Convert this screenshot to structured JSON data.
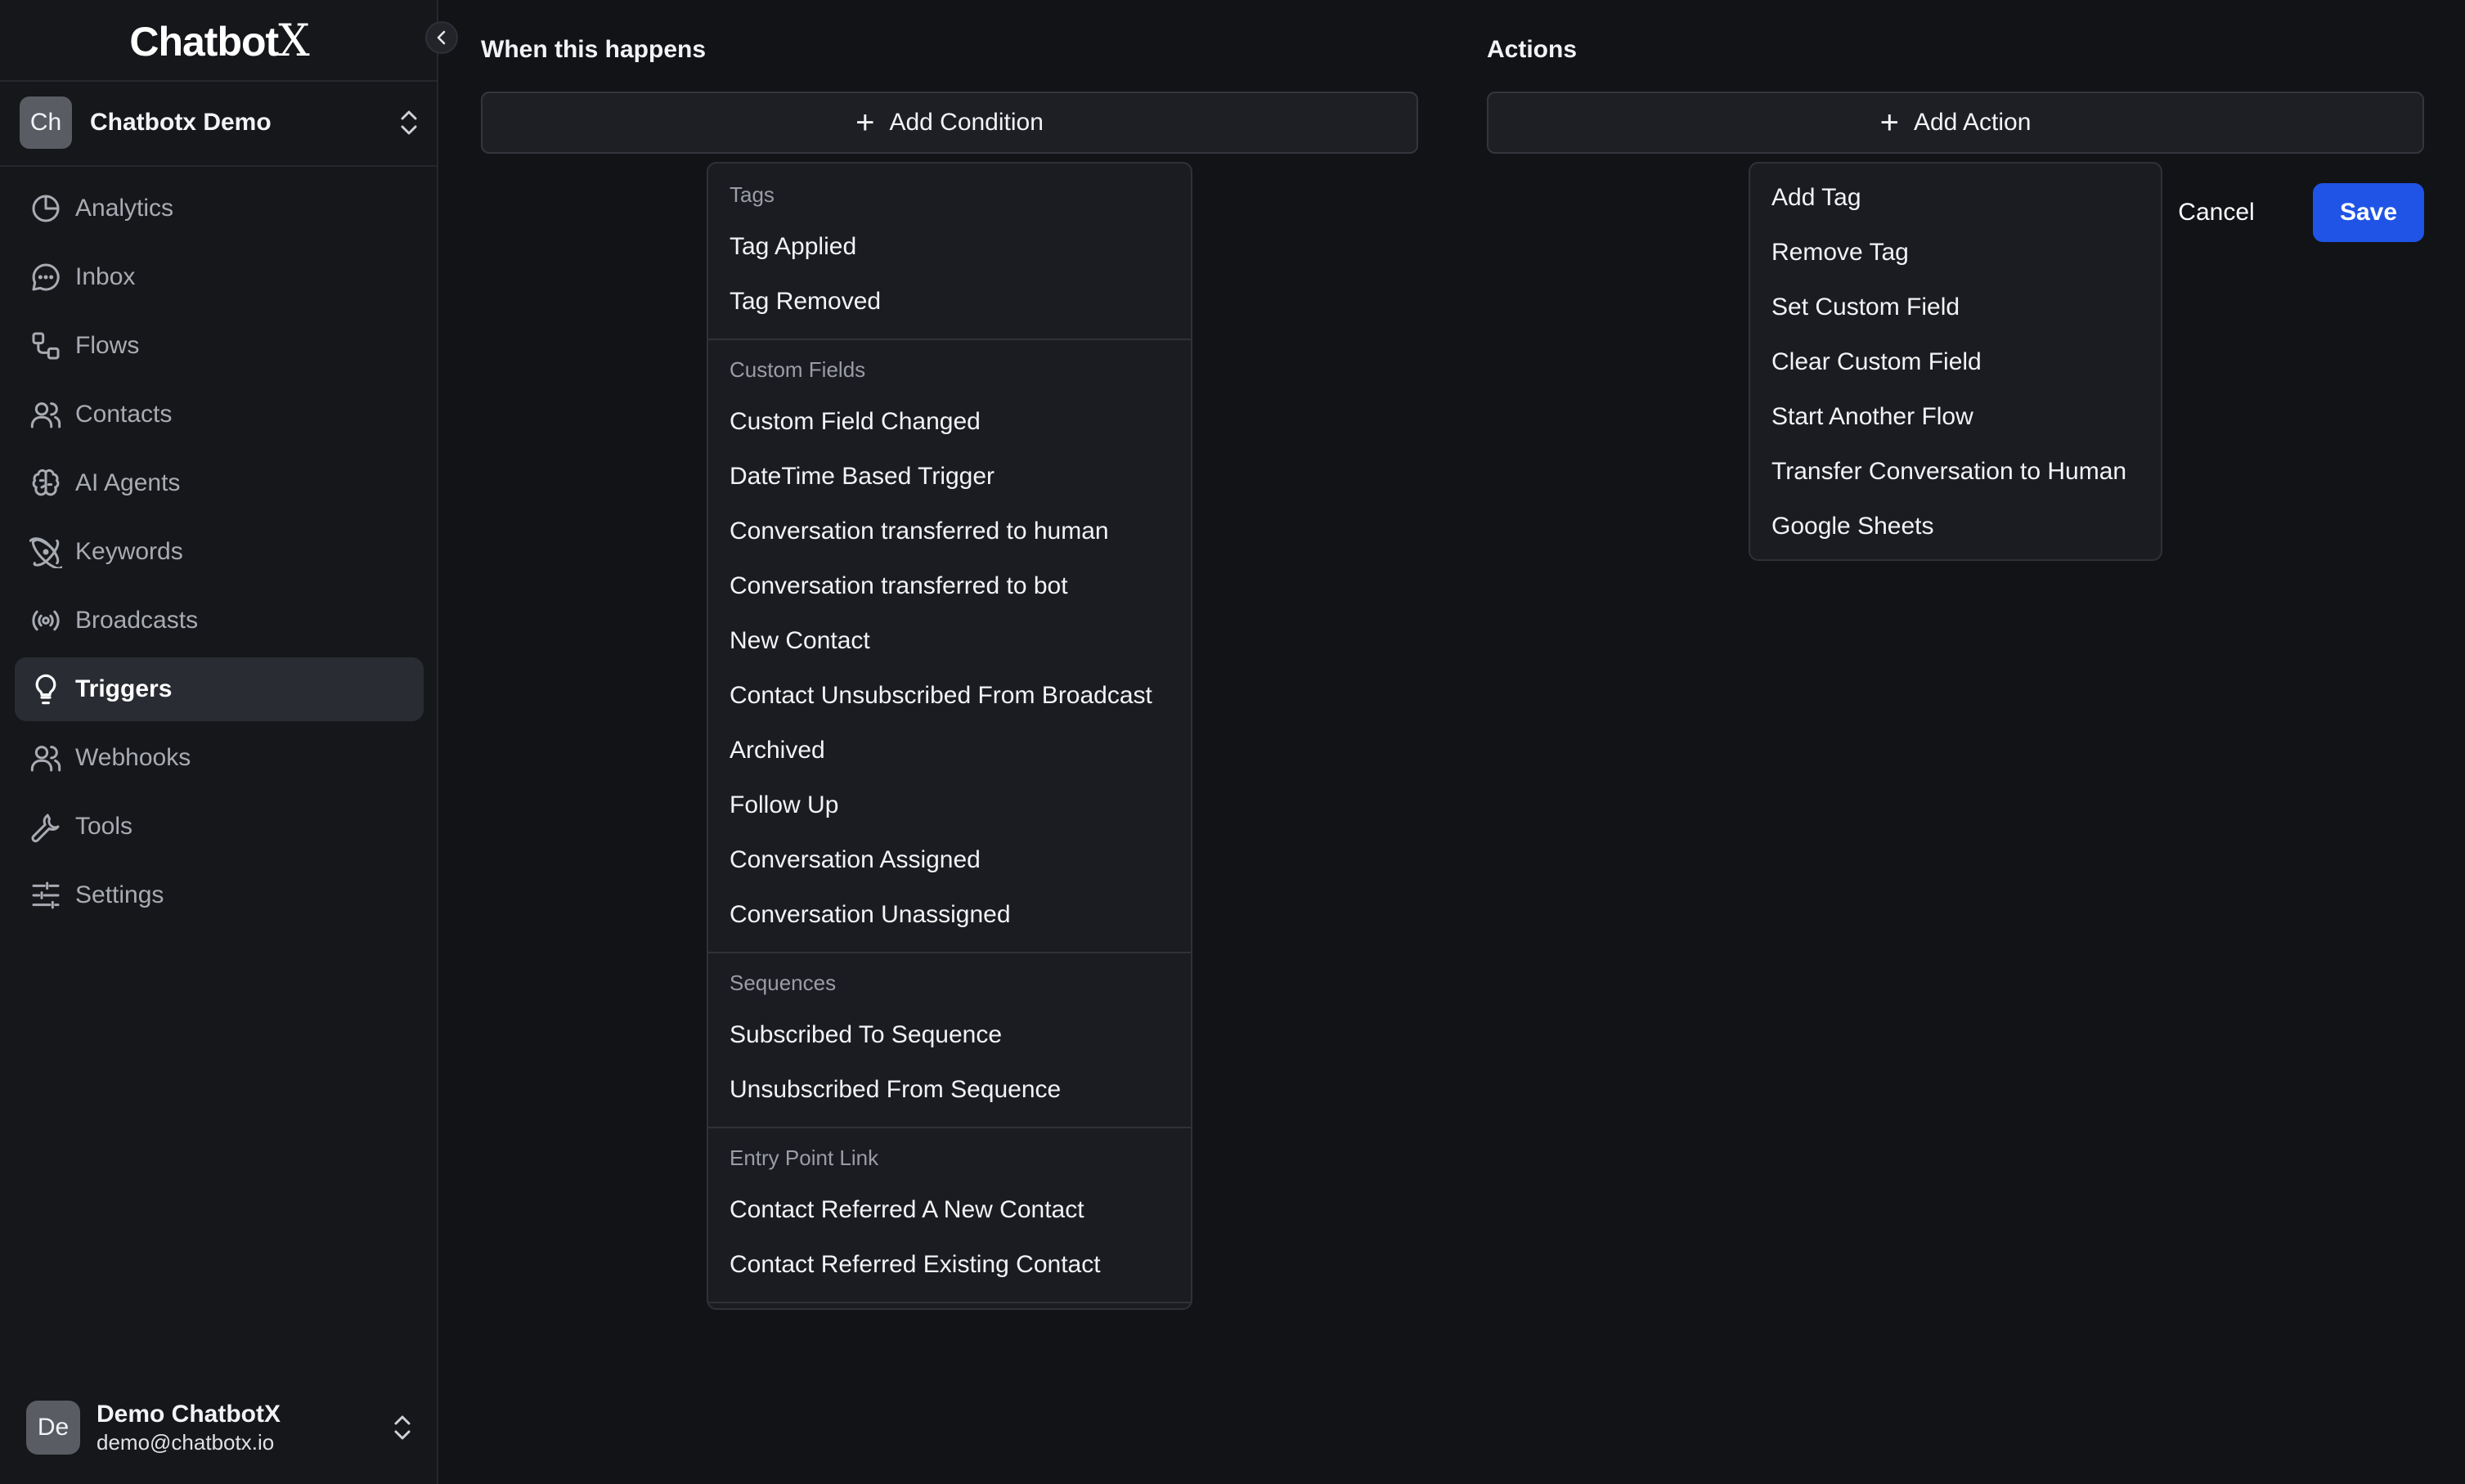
{
  "app": {
    "logo_text": "Chatbot",
    "logo_mark": "X"
  },
  "workspace": {
    "avatar": "Ch",
    "name": "Chatbotx Demo"
  },
  "nav": [
    {
      "label": "Analytics",
      "icon": "pie-chart-icon"
    },
    {
      "label": "Inbox",
      "icon": "chat-bubble-icon"
    },
    {
      "label": "Flows",
      "icon": "flow-icon"
    },
    {
      "label": "Contacts",
      "icon": "users-icon"
    },
    {
      "label": "AI Agents",
      "icon": "brain-icon"
    },
    {
      "label": "Keywords",
      "icon": "atom-icon"
    },
    {
      "label": "Broadcasts",
      "icon": "broadcast-icon"
    },
    {
      "label": "Triggers",
      "icon": "lightbulb-icon",
      "active": true
    },
    {
      "label": "Webhooks",
      "icon": "users-icon"
    },
    {
      "label": "Tools",
      "icon": "wrench-icon"
    },
    {
      "label": "Settings",
      "icon": "sliders-icon"
    }
  ],
  "user": {
    "avatar": "De",
    "name": "Demo ChatbotX",
    "email": "demo@chatbotx.io"
  },
  "conditions": {
    "title": "When this happens",
    "add_label": "Add Condition",
    "groups": [
      {
        "label": "Tags",
        "items": [
          "Tag Applied",
          "Tag Removed"
        ]
      },
      {
        "label": "Custom Fields",
        "items": [
          "Custom Field Changed",
          "DateTime Based Trigger",
          "Conversation transferred to human",
          "Conversation transferred to bot",
          "New Contact",
          "Contact Unsubscribed From Broadcast",
          "Archived",
          "Follow Up",
          "Conversation Assigned",
          "Conversation Unassigned"
        ]
      },
      {
        "label": "Sequences",
        "items": [
          "Subscribed To Sequence",
          "Unsubscribed From Sequence"
        ]
      },
      {
        "label": "Entry Point Link",
        "items": [
          "Contact Referred A New Contact",
          "Contact Referred Existing Contact"
        ]
      }
    ]
  },
  "actions": {
    "title": "Actions",
    "add_label": "Add Action",
    "items": [
      "Add Tag",
      "Remove Tag",
      "Set Custom Field",
      "Clear Custom Field",
      "Start Another Flow",
      "Transfer Conversation to Human",
      "Google Sheets"
    ]
  },
  "buttons": {
    "cancel": "Cancel",
    "save": "Save"
  },
  "colors": {
    "background": "#121317",
    "sidebar": "#16171b",
    "accent": "#1f54e6",
    "active_nav": "#2a2c33"
  }
}
